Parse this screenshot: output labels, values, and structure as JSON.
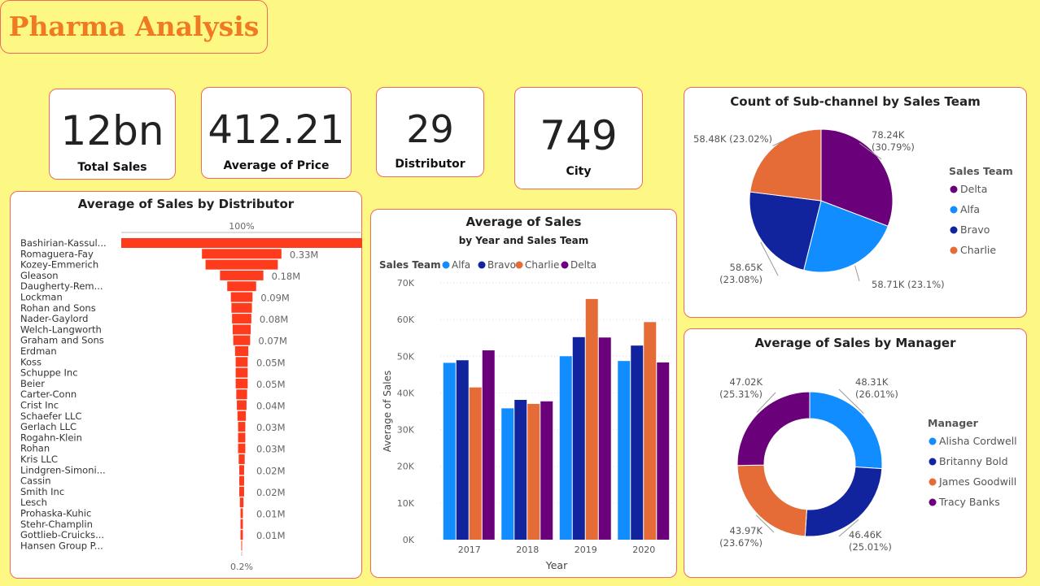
{
  "header": {
    "title": "Pharma Analysis"
  },
  "kpis": [
    {
      "value": "12bn",
      "label": "Total Sales"
    },
    {
      "value": "412.21",
      "label": "Average of Price"
    },
    {
      "value": "29",
      "label": "Distributor"
    },
    {
      "value": "749",
      "label": "City"
    }
  ],
  "colors": {
    "alfa": "#118dff",
    "bravo": "#12239e",
    "charlie": "#e66c37",
    "delta": "#6b007b",
    "funnel": "#ff3b1d",
    "border": "#f06a62",
    "background": "#fdf784"
  },
  "chart_data": [
    {
      "type": "bar",
      "orientation": "horizontal-funnel",
      "title": "Average of Sales by Distributor",
      "top_label": "100%",
      "bottom_label": "0.2%",
      "categories": [
        "Bashirian-Kassul...",
        "Romaguera-Fay",
        "Kozey-Emmerich",
        "Gleason",
        "Daugherty-Rem...",
        "Lockman",
        "Rohan and Sons",
        "Nader-Gaylord",
        "Welch-Langworth",
        "Graham and Sons",
        "Erdman",
        "Koss",
        "Schuppe Inc",
        "Beier",
        "Carter-Conn",
        "Crist Inc",
        "Schaefer LLC",
        "Gerlach LLC",
        "Rogahn-Klein",
        "Rohan",
        "Kris LLC",
        "Lindgren-Simoni...",
        "Cassin",
        "Smith Inc",
        "Lesch",
        "Prohaska-Kuhic",
        "Stehr-Champlin",
        "Gottlieb-Cruicks...",
        "Hansen Group P..."
      ],
      "values": [
        1.0,
        0.33,
        0.3,
        0.18,
        0.12,
        0.09,
        0.085,
        0.08,
        0.075,
        0.07,
        0.055,
        0.05,
        0.05,
        0.05,
        0.045,
        0.04,
        0.035,
        0.03,
        0.03,
        0.03,
        0.025,
        0.02,
        0.02,
        0.02,
        0.015,
        0.01,
        0.01,
        0.01,
        0.002
      ],
      "value_labels": [
        "",
        "0.33M",
        "",
        "0.18M",
        "",
        "0.09M",
        "",
        "0.08M",
        "",
        "0.07M",
        "",
        "0.05M",
        "",
        "0.05M",
        "",
        "0.04M",
        "",
        "0.03M",
        "",
        "0.03M",
        "",
        "0.02M",
        "",
        "0.02M",
        "",
        "0.01M",
        "",
        "0.01M",
        ""
      ]
    },
    {
      "type": "bar",
      "title": "Average of Sales",
      "subtitle": "by Year and Sales Team",
      "legend_title": "Sales Team",
      "xlabel": "Year",
      "ylabel": "Average of Sales",
      "ylim": [
        0,
        70000
      ],
      "yticks": [
        "0K",
        "10K",
        "20K",
        "30K",
        "40K",
        "50K",
        "60K",
        "70K"
      ],
      "categories": [
        "2017",
        "2018",
        "2019",
        "2020"
      ],
      "series": [
        {
          "name": "Alfa",
          "values": [
            48200,
            35800,
            50000,
            48700
          ]
        },
        {
          "name": "Bravo",
          "values": [
            48900,
            38100,
            55200,
            52900
          ]
        },
        {
          "name": "Charlie",
          "values": [
            41500,
            37000,
            65600,
            59300
          ]
        },
        {
          "name": "Delta",
          "values": [
            51600,
            37700,
            55100,
            48300
          ]
        }
      ]
    },
    {
      "type": "pie",
      "title": "Count of Sub-channel by Sales Team",
      "legend_title": "Sales Team",
      "labels": [
        "Delta",
        "Alfa",
        "Bravo",
        "Charlie"
      ],
      "values": [
        78240,
        58710,
        58650,
        58480
      ],
      "data_labels": [
        "78.24K\n(30.79%)",
        "58.71K (23.1%)",
        "58.65K\n(23.08%)",
        "58.48K (23.02%)"
      ]
    },
    {
      "type": "pie",
      "subtype": "donut",
      "title": "Average of Sales by Manager",
      "legend_title": "Manager",
      "labels": [
        "Alisha Cordwell",
        "Britanny Bold",
        "James Goodwill",
        "Tracy Banks"
      ],
      "values": [
        48310,
        46460,
        43970,
        47020
      ],
      "data_labels": [
        "48.31K\n(26.01%)",
        "46.46K\n(25.01%)",
        "43.97K\n(23.67%)",
        "47.02K\n(25.31%)"
      ]
    }
  ]
}
